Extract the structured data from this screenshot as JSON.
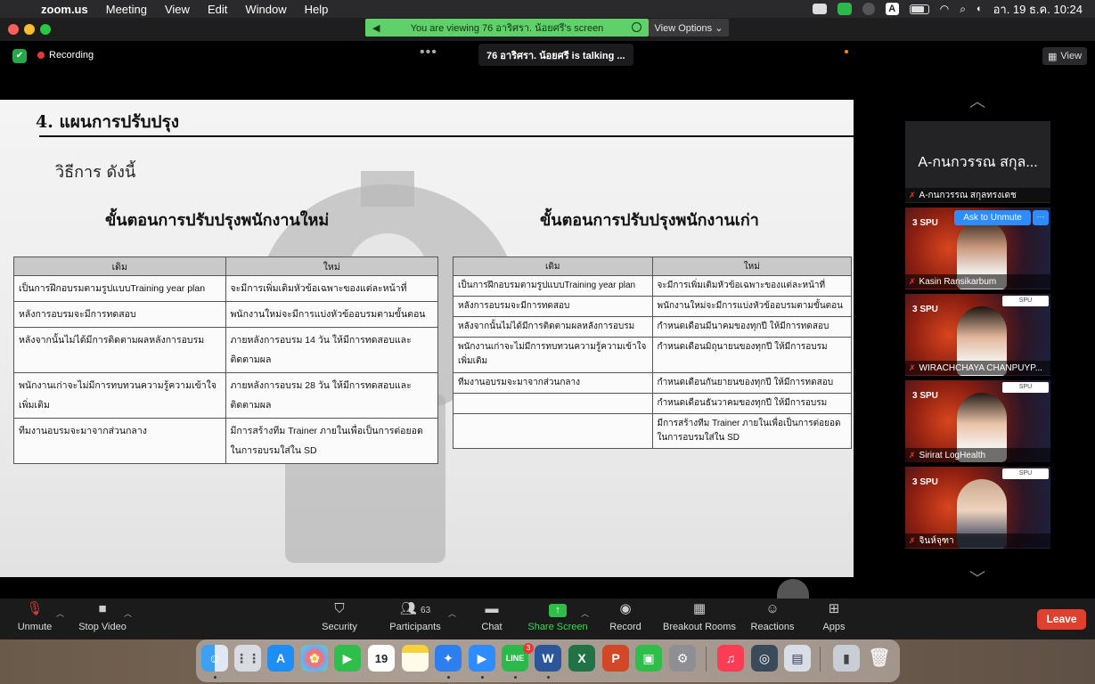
{
  "menubar": {
    "app": "zoom.us",
    "items": [
      "Meeting",
      "View",
      "Edit",
      "Window",
      "Help"
    ],
    "clock": "อา. 19 ธ.ค.  10:24"
  },
  "banner": {
    "viewing": "You are viewing 76 อาริศรา. น้อยศรี's screen",
    "view_options": "View Options ⌄"
  },
  "meeting": {
    "recording": "Recording",
    "talking": "76 อาริศรา. น้อยศรี is talking ..."
  },
  "slide": {
    "heading": "4. แผนการปรับปรุง",
    "method": "วิธีการ ดังนี้",
    "new_title": "ขั้นตอนการปรับปรุงพนักงานใหม่",
    "old_title": "ขั้นตอนการปรับปรุงพนักงานเก่า",
    "new_table": {
      "headers": [
        "เดิม",
        "ใหม่"
      ],
      "rows": [
        [
          "เป็นการฝึกอบรมตามรูปแบบTraining year plan",
          "จะมีการเพิ่มเติมหัวข้อเฉพาะของแต่ละหน้าที่"
        ],
        [
          "หลังการอบรมจะมีการทดสอบ",
          "พนักงานใหม่จะมีการแบ่งหัวข้ออบรมตามขั้นตอน"
        ],
        [
          "หลังจากนั้นไม่ได้มีการติดตามผลหลังการอบรม",
          "ภายหลังการอบรม 14 วัน ให้มีการทดสอบและติดตามผล"
        ],
        [
          "พนักงานเก่าจะไม่มีการทบทวนความรู้ความเข้าใจเพิ่มเติม",
          "ภายหลังการอบรม 28 วัน ให้มีการทดสอบและติดตามผล"
        ],
        [
          "ทีมงานอบรมจะมาจากส่วนกลาง",
          "มีการสร้างทีม Trainer ภายในเพื่อเป็นการต่อยอดในการอบรมใส่ใน SD"
        ]
      ]
    },
    "old_table": {
      "headers": [
        "เดิม",
        "ใหม่"
      ],
      "rows": [
        [
          "เป็นการฝึกอบรมตามรูปแบบTraining year plan",
          "จะมีการเพิ่มเติมหัวข้อเฉพาะของแต่ละหน้าที่"
        ],
        [
          "หลังการอบรมจะมีการทดสอบ",
          "พนักงานใหม่จะมีการแบ่งหัวข้ออบรมตามขั้นตอน"
        ],
        [
          "หลังจากนั้นไม่ได้มีการติดตามผลหลังการอบรม",
          "กำหนดเดือนมีนาคมของทุกปี ให้มีการทดสอบ"
        ],
        [
          "พนักงานเก่าจะไม่มีการทบทวนความรู้ความเข้าใจเพิ่มเติม",
          "กำหนดเดือนมิถุนายนของทุกปี ให้มีการอบรม"
        ],
        [
          "ทีมงานอบรมจะมาจากส่วนกลาง",
          "กำหนดเดือนกันยายนของทุกปี ให้มีการทดสอบ"
        ],
        [
          "",
          "กำหนดเดือนธันวาคมของทุกปี ให้มีการอบรม"
        ],
        [
          "",
          "มีการสร้างทีม Trainer ภายในเพื่อเป็นการต่อยอดในการอบรมใส่ใน SD"
        ]
      ]
    }
  },
  "gallery": {
    "view_label": "View",
    "name_tile_big": "A-กนกวรรณ สกุล...",
    "participants": [
      {
        "name": "A-กนกวรรณ สกุลทรงเดช"
      },
      {
        "name": "Kasin Ransikarbum"
      },
      {
        "name": "WIRACHCHAYA CHANPUYP..."
      },
      {
        "name": "Sirirat LogHealth"
      },
      {
        "name": "จินห์จุฑา"
      }
    ],
    "ask_unmute": "Ask to Unmute",
    "more": "···",
    "tile_logo": "3 SPU",
    "tile_badge": "SPU"
  },
  "toolbar": {
    "unmute": "Unmute",
    "stop_video": "Stop Video",
    "security": "Security",
    "participants": "Participants",
    "participant_count": "63",
    "chat": "Chat",
    "share_screen": "Share Screen",
    "record": "Record",
    "breakout": "Breakout Rooms",
    "reactions": "Reactions",
    "apps": "Apps",
    "leave": "Leave"
  },
  "dock": {
    "calendar_day": "19",
    "line_badge": "3"
  }
}
